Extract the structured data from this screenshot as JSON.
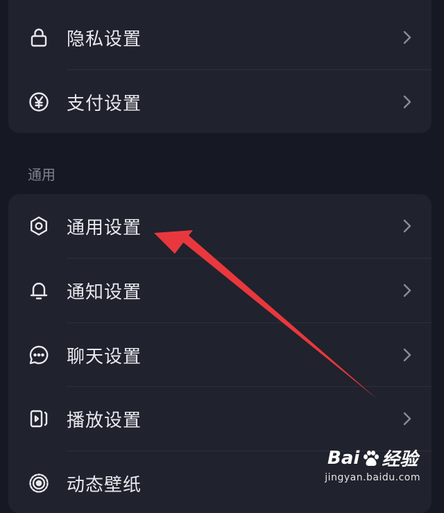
{
  "group_account": {
    "items": [
      {
        "label": "隐私设置",
        "icon": "lock-icon"
      },
      {
        "label": "支付设置",
        "icon": "yuan-icon"
      }
    ]
  },
  "section_general": {
    "title": "通用"
  },
  "group_general": {
    "items": [
      {
        "label": "通用设置",
        "icon": "gear-icon"
      },
      {
        "label": "通知设置",
        "icon": "bell-icon"
      },
      {
        "label": "聊天设置",
        "icon": "chat-bubble-icon"
      },
      {
        "label": "播放设置",
        "icon": "play-icon"
      },
      {
        "label": "动态壁纸",
        "icon": "live-wallpaper-icon"
      }
    ]
  },
  "watermark": {
    "brand_left": "Bai",
    "brand_right": "经验",
    "url": "jingyan.baidu.com"
  },
  "colors": {
    "background": "#161823",
    "card": "#20222d",
    "text": "#e8e9ee",
    "muted": "#80828c",
    "arrow": "#e8383d"
  }
}
